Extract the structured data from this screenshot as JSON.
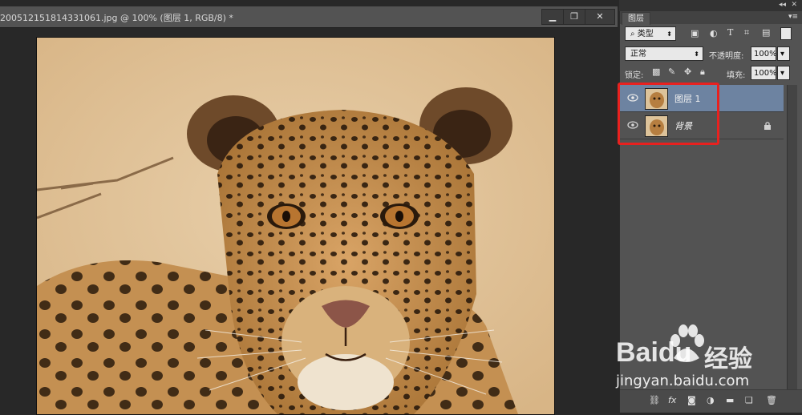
{
  "document": {
    "title": "200512151814331061.jpg @ 100% (图层 1, RGB/8) *",
    "controls": {
      "minimize": "▁",
      "restore": "❐",
      "close": "✕"
    }
  },
  "panel": {
    "tab_label": "图层",
    "filter": {
      "kind_label": "类型"
    },
    "blend_mode": "正常",
    "opacity_label": "不透明度:",
    "opacity_value": "100%",
    "lock_label": "锁定:",
    "fill_label": "填充:",
    "fill_value": "100%",
    "layers": [
      {
        "name": "图层 1",
        "selected": true
      },
      {
        "name": "背景",
        "selected": false,
        "locked": true
      }
    ]
  },
  "watermark": {
    "brand": "Baidu",
    "brand_cn": "经验",
    "url": "jingyan.baidu.com"
  },
  "colors": {
    "highlight": "#e8211f",
    "selected_layer": "#6d83a1",
    "panel_bg": "#535353"
  }
}
